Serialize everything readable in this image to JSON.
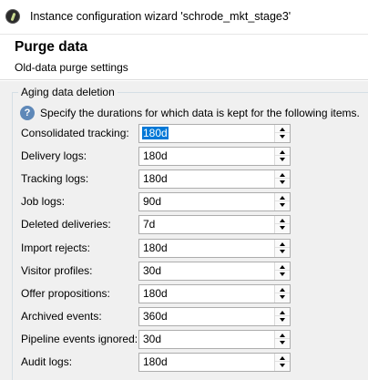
{
  "window": {
    "title": "Instance configuration wizard 'schrode_mkt_stage3'",
    "app_icon": "app-logo-icon"
  },
  "header": {
    "title": "Purge data",
    "subtitle": "Old-data purge settings"
  },
  "group": {
    "legend": "Aging data deletion",
    "info_icon": "help-icon",
    "info_text": "Specify the durations for which data is kept for the following items."
  },
  "fields": [
    {
      "label": "Consolidated tracking:",
      "value": "180d",
      "selected": true
    },
    {
      "label": "Delivery logs:",
      "value": "180d"
    },
    {
      "label": "Tracking logs:",
      "value": "180d"
    },
    {
      "label": "Job logs:",
      "value": "90d"
    },
    {
      "label": "Deleted deliveries:",
      "value": "7d"
    },
    {
      "label": "Import rejects:",
      "value": "180d"
    },
    {
      "label": "Visitor profiles:",
      "value": "30d"
    },
    {
      "label": "Offer propositions:",
      "value": "180d"
    },
    {
      "label": "Archived events:",
      "value": "360d"
    },
    {
      "label": "Pipeline events ignored:",
      "value": "30d"
    },
    {
      "label": "Audit logs:",
      "value": "180d"
    }
  ],
  "colors": {
    "selection": "#0078d7",
    "help_icon": "#5e88b8",
    "panel_background": "#f0f0f0"
  }
}
